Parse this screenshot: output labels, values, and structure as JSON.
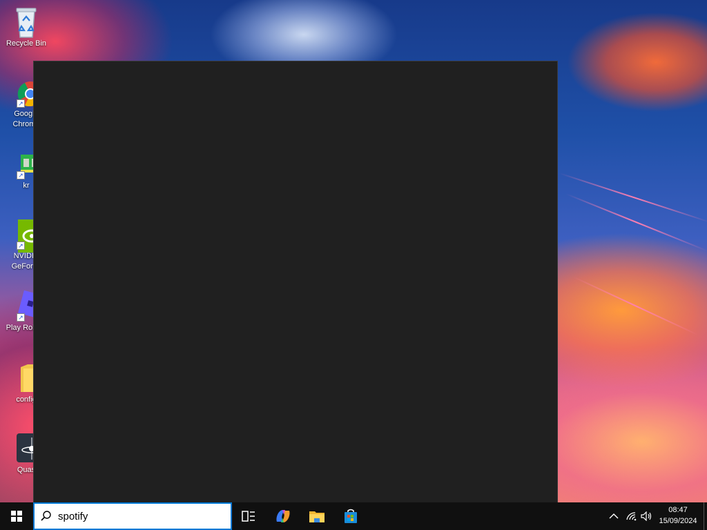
{
  "desktop": {
    "icons": [
      {
        "label": "Recycle Bin",
        "icon": "recycle-bin-icon"
      },
      {
        "label": "Google Chrome",
        "icon": "chrome-icon"
      },
      {
        "label": "kr",
        "icon": "kr-app-icon"
      },
      {
        "label": "NVIDIA GeForce",
        "icon": "nvidia-icon"
      },
      {
        "label": "Play Roblox",
        "icon": "roblox-icon"
      },
      {
        "label": "config",
        "icon": "folder-icon"
      },
      {
        "label": "Quas",
        "icon": "quas-app-icon"
      }
    ]
  },
  "search_panel": {
    "state": "empty"
  },
  "taskbar": {
    "start_icon": "windows-logo-icon",
    "search": {
      "icon": "search-icon",
      "value": "spotify"
    },
    "apps": [
      {
        "name": "Task View",
        "icon": "task-view-icon"
      },
      {
        "name": "Copilot",
        "icon": "copilot-icon"
      },
      {
        "name": "File Explorer",
        "icon": "file-explorer-icon"
      },
      {
        "name": "Microsoft Store",
        "icon": "microsoft-store-icon"
      }
    ],
    "tray": {
      "chevron_icon": "chevron-up-icon",
      "network_icon": "network-icon",
      "volume_icon": "volume-icon"
    },
    "clock": {
      "time": "08:47",
      "date": "15/09/2024"
    }
  },
  "colors": {
    "panel_bg": "#202020",
    "taskbar_bg": "#101010",
    "accent": "#0078d4"
  }
}
